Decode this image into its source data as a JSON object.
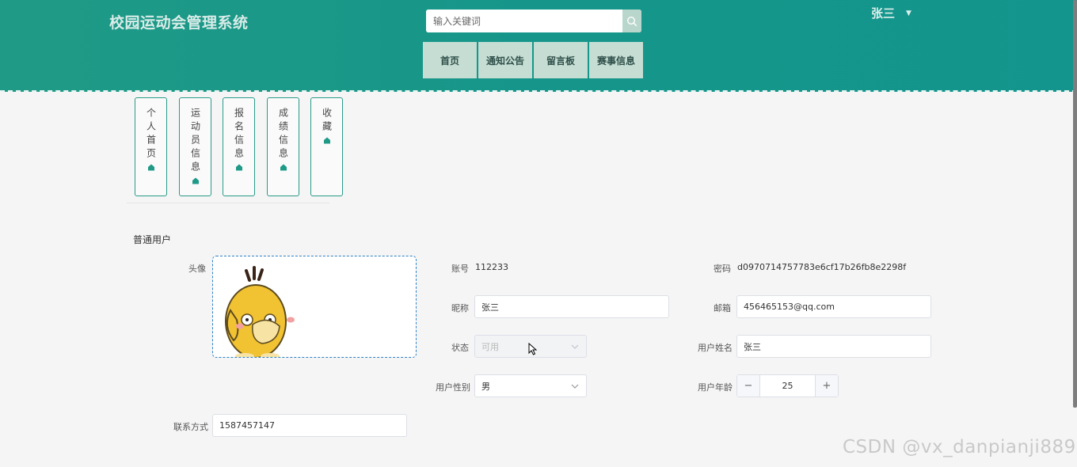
{
  "header": {
    "app_title": "校园运动会管理系统",
    "search_placeholder": "输入关键词",
    "user_name": "张三",
    "bg_color": "#16968a"
  },
  "nav": [
    {
      "label": "首页"
    },
    {
      "label": "通知公告"
    },
    {
      "label": "留言板"
    },
    {
      "label": "赛事信息"
    }
  ],
  "subtabs": [
    {
      "label": "个人首页"
    },
    {
      "label": "运动员信息"
    },
    {
      "label": "报名信息"
    },
    {
      "label": "成绩信息"
    },
    {
      "label": "收藏"
    }
  ],
  "section_title": "普通用户",
  "form": {
    "avatar_label": "头像",
    "account_label": "账号",
    "account_value": "112233",
    "password_label": "密码",
    "password_value": "d0970714757783e6cf17b26fb8e2298f",
    "nickname_label": "昵称",
    "nickname_value": "张三",
    "email_label": "邮箱",
    "email_value": "456465153@qq.com",
    "status_label": "状态",
    "status_value": "可用",
    "realname_label": "用户姓名",
    "realname_value": "张三",
    "gender_label": "用户性别",
    "gender_value": "男",
    "age_label": "用户年龄",
    "age_value": "25",
    "contact_label": "联系方式",
    "contact_value": "1587457147"
  },
  "watermark": "CSDN @vx_danpianji889"
}
